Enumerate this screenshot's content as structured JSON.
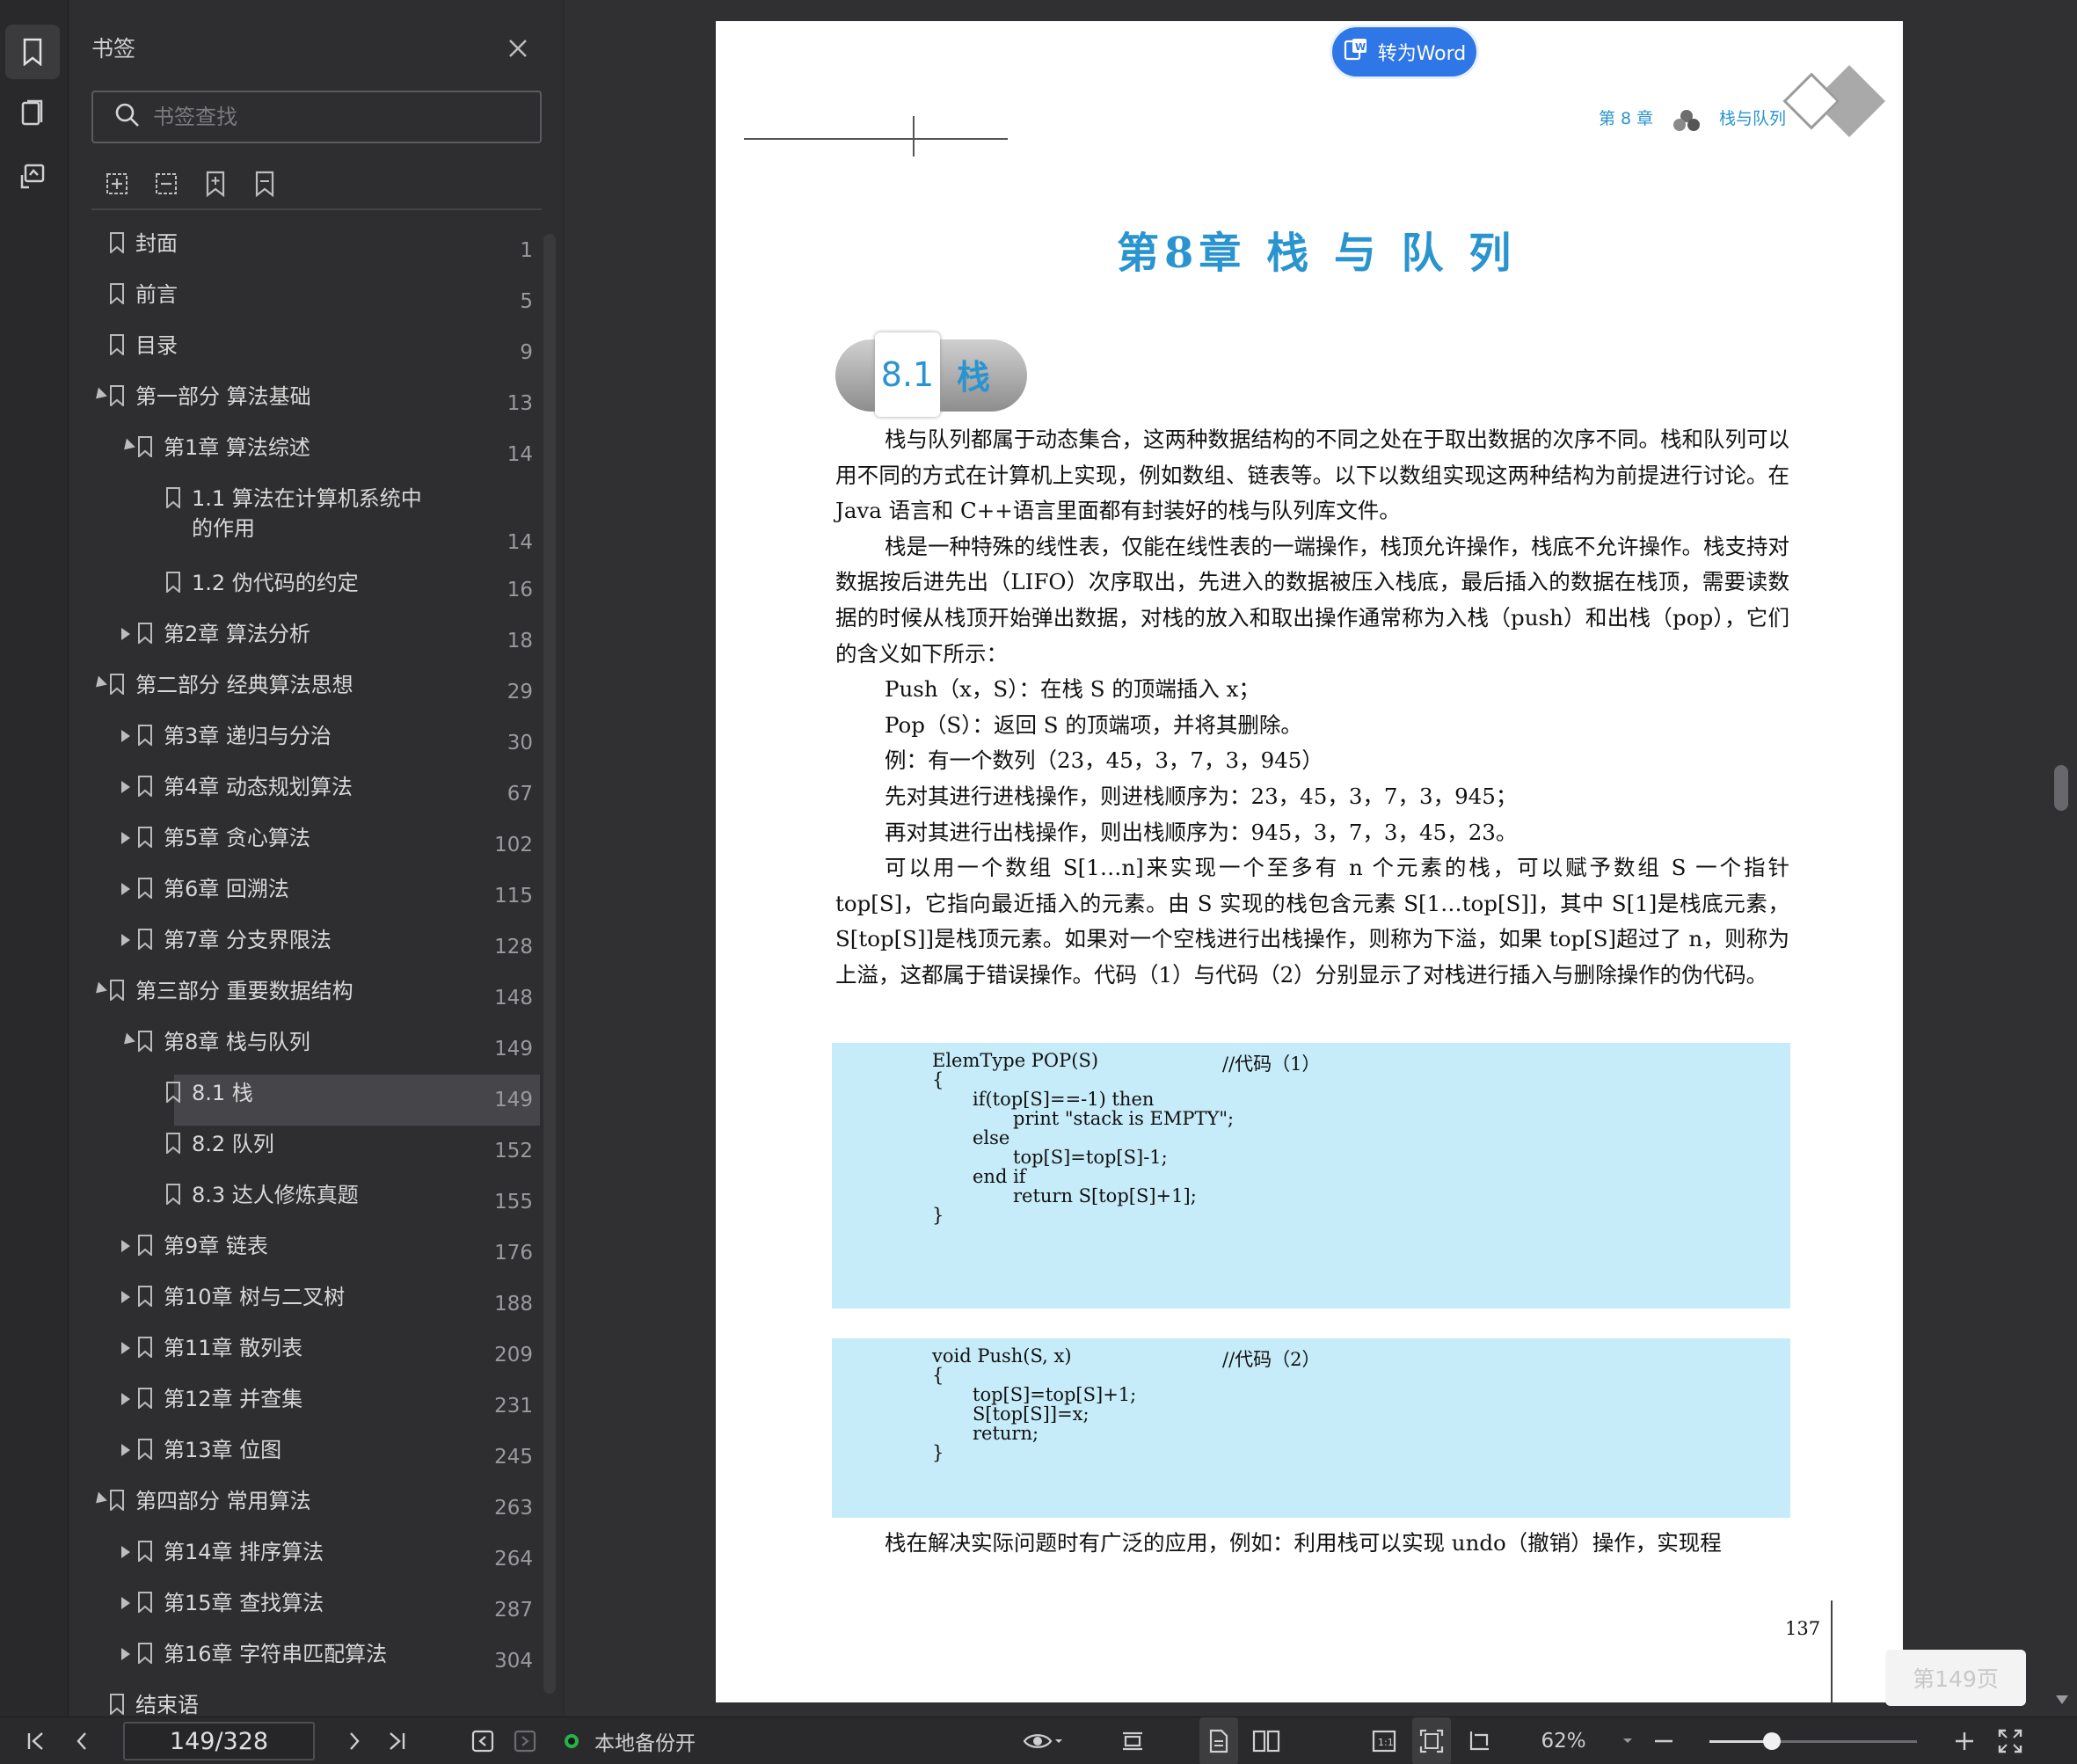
{
  "sidebar": {
    "title": "书签",
    "search_placeholder": "书签查找",
    "items": [
      {
        "label": "封面",
        "page": "1",
        "level": 0,
        "expander": "none"
      },
      {
        "label": "前言",
        "page": "5",
        "level": 0,
        "expander": "none"
      },
      {
        "label": "目录",
        "page": "9",
        "level": 0,
        "expander": "none"
      },
      {
        "label": "第一部分 算法基础",
        "page": "13",
        "level": 0,
        "expander": "open"
      },
      {
        "label": "第1章 算法综述",
        "page": "14",
        "level": 1,
        "expander": "open"
      },
      {
        "label": "1.1 算法在计算机系统中",
        "label2": "的作用",
        "page": "14",
        "level": 2,
        "expander": "none"
      },
      {
        "label": "1.2 伪代码的约定",
        "page": "16",
        "level": 2,
        "expander": "none"
      },
      {
        "label": "第2章 算法分析",
        "page": "18",
        "level": 1,
        "expander": "closed"
      },
      {
        "label": "第二部分 经典算法思想",
        "page": "29",
        "level": 0,
        "expander": "open"
      },
      {
        "label": "第3章 递归与分治",
        "page": "30",
        "level": 1,
        "expander": "closed"
      },
      {
        "label": "第4章 动态规划算法",
        "page": "67",
        "level": 1,
        "expander": "closed"
      },
      {
        "label": "第5章 贪心算法",
        "page": "102",
        "level": 1,
        "expander": "closed"
      },
      {
        "label": "第6章 回溯法",
        "page": "115",
        "level": 1,
        "expander": "closed"
      },
      {
        "label": "第7章 分支界限法",
        "page": "128",
        "level": 1,
        "expander": "closed"
      },
      {
        "label": "第三部分 重要数据结构",
        "page": "148",
        "level": 0,
        "expander": "open"
      },
      {
        "label": "第8章 栈与队列",
        "page": "149",
        "level": 1,
        "expander": "open"
      },
      {
        "label": "8.1 栈",
        "page": "149",
        "level": 2,
        "expander": "none",
        "selected": true
      },
      {
        "label": "8.2 队列",
        "page": "152",
        "level": 2,
        "expander": "none"
      },
      {
        "label": "8.3 达人修炼真题",
        "page": "155",
        "level": 2,
        "expander": "none"
      },
      {
        "label": "第9章 链表",
        "page": "176",
        "level": 1,
        "expander": "closed"
      },
      {
        "label": "第10章 树与二叉树",
        "page": "188",
        "level": 1,
        "expander": "closed"
      },
      {
        "label": "第11章 散列表",
        "page": "209",
        "level": 1,
        "expander": "closed"
      },
      {
        "label": "第12章 并查集",
        "page": "231",
        "level": 1,
        "expander": "closed"
      },
      {
        "label": "第13章 位图",
        "page": "245",
        "level": 1,
        "expander": "closed"
      },
      {
        "label": "第四部分 常用算法",
        "page": "263",
        "level": 0,
        "expander": "open"
      },
      {
        "label": "第14章 排序算法",
        "page": "264",
        "level": 1,
        "expander": "closed"
      },
      {
        "label": "第15章 查找算法",
        "page": "287",
        "level": 1,
        "expander": "closed"
      },
      {
        "label": "第16章 字符串匹配算法",
        "page": "304",
        "level": 1,
        "expander": "closed"
      },
      {
        "label": "结束语",
        "page": "",
        "level": 0,
        "expander": "none"
      }
    ]
  },
  "toolbar": {
    "to_word_label": "转为Word"
  },
  "document": {
    "header_chapter": "第 8 章",
    "header_title": "栈与队列",
    "chapter_title": "第8章  栈 与 队 列",
    "section_number": "8.1",
    "section_name": "栈",
    "paragraphs": [
      {
        "style": "ind",
        "text": "栈与队列都属于动态集合，这两种数据结构的不同之处在于取出数据的次序不同。栈和队列可以用不同的方式在计算机上实现，例如数组、链表等。以下以数组实现这两种结构为前提进行讨论。在 Java 语言和 C++语言里面都有封装好的栈与队列库文件。"
      },
      {
        "style": "ind",
        "text": "栈是一种特殊的线性表，仅能在线性表的一端操作，栈顶允许操作，栈底不允许操作。栈支持对数据按后进先出（LIFO）次序取出，先进入的数据被压入栈底，最后插入的数据在栈顶，需要读数据的时候从栈顶开始弹出数据，对栈的放入和取出操作通常称为入栈（push）和出栈（pop），它们的含义如下所示："
      },
      {
        "style": "sub",
        "text": "Push（x，S）：在栈 S 的顶端插入 x；"
      },
      {
        "style": "sub",
        "text": "Pop（S）：返回 S 的顶端项，并将其删除。"
      },
      {
        "style": "sub",
        "text": "例：有一个数列（23，45，3，7，3，945）"
      },
      {
        "style": "sub",
        "text": "先对其进行进栈操作，则进栈顺序为：23，45，3，7，3，945；"
      },
      {
        "style": "sub",
        "text": "再对其进行出栈操作，则出栈顺序为：945，3，7，3，45，23。"
      },
      {
        "style": "ind",
        "text": "可以用一个数组 S[1…n]来实现一个至多有 n 个元素的栈，可以赋予数组 S 一个指针 top[S]，它指向最近插入的元素。由 S 实现的栈包含元素 S[1…top[S]]，其中 S[1]是栈底元素，S[top[S]]是栈顶元素。如果对一个空栈进行出栈操作，则称为下溢，如果 top[S]超过了 n，则称为上溢，这都属于错误操作。代码（1）与代码（2）分别显示了对栈进行插入与删除操作的伪代码。"
      }
    ],
    "code1": {
      "comment": "//代码（1）",
      "lines": [
        {
          "indent": 0,
          "text": "ElemType POP(S)"
        },
        {
          "indent": 0,
          "text": "{"
        },
        {
          "indent": 1,
          "text": "if(top[S]==-1) then"
        },
        {
          "indent": 2,
          "text": "print \"stack is EMPTY\";"
        },
        {
          "indent": 1,
          "text": "else"
        },
        {
          "indent": 2,
          "text": "top[S]=top[S]-1;"
        },
        {
          "indent": 1,
          "text": "end if"
        },
        {
          "indent": 2,
          "text": "return S[top[S]+1];"
        },
        {
          "indent": 0,
          "text": "}"
        }
      ]
    },
    "code2": {
      "comment": "//代码（2）",
      "lines": [
        {
          "indent": 0,
          "text": "void Push(S, x)"
        },
        {
          "indent": 0,
          "text": "{"
        },
        {
          "indent": 1,
          "text": "top[S]=top[S]+1;"
        },
        {
          "indent": 1,
          "text": "S[top[S]]=x;"
        },
        {
          "indent": 1,
          "text": "return;"
        },
        {
          "indent": 0,
          "text": "}"
        }
      ]
    },
    "last_line": "栈在解决实际问题时有广泛的应用，例如：利用栈可以实现 undo（撤销）操作，实现程",
    "page_number": "137",
    "page_toast": "第149页"
  },
  "statusbar": {
    "page_value": "149/328",
    "backup_label": "本地备份开",
    "zoom": "62%",
    "zoom_fraction": 0.3,
    "backup_dot_color": "#27b34a"
  },
  "colors": {
    "accent": "#2a94cf",
    "word_button": "#2f76e6",
    "code_bg": "#c6ebf9"
  },
  "icons": {
    "rail": [
      "bookmark-icon",
      "thumbnail-icon",
      "annotation-icon"
    ],
    "tools": [
      "expand-all-icon",
      "collapse-all-icon",
      "add-bookmark-icon",
      "bookmark-outline-icon"
    ]
  }
}
